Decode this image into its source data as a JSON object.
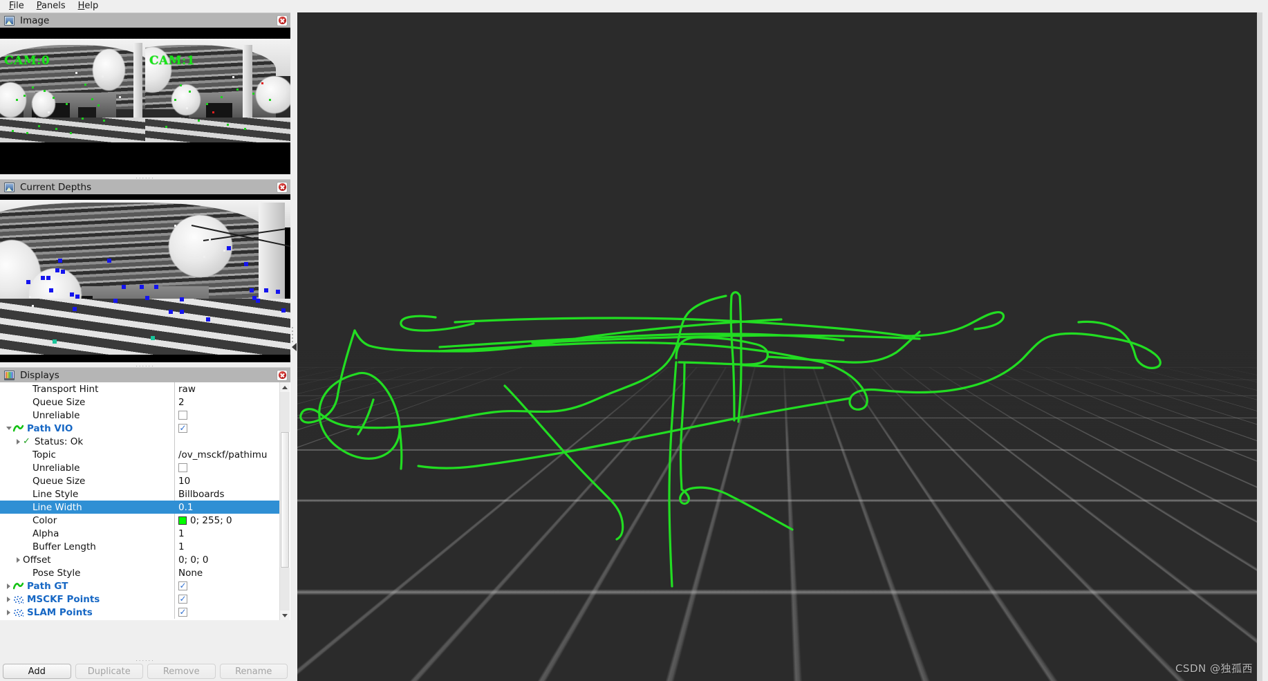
{
  "menu": {
    "items": [
      {
        "label": "File",
        "mnemonic": "F"
      },
      {
        "label": "Panels",
        "mnemonic": "P"
      },
      {
        "label": "Help",
        "mnemonic": "H"
      }
    ]
  },
  "panels": {
    "image": {
      "title": "Image",
      "icon": "image-panel-icon",
      "close_icon": "close-icon",
      "cam_labels": [
        "CAM:0",
        "CAM:1"
      ],
      "feature_color": "#1dd21d"
    },
    "depths": {
      "title": "Current Depths",
      "icon": "image-panel-icon",
      "close_icon": "close-icon",
      "feature_color": "#1414ee"
    },
    "displays": {
      "title": "Displays",
      "icon": "displays-panel-icon",
      "close_icon": "close-icon"
    }
  },
  "properties": [
    {
      "indent": 2,
      "arrow": "none",
      "label": "Transport Hint",
      "value": "raw",
      "value_type": "text",
      "group": false,
      "selected": false
    },
    {
      "indent": 2,
      "arrow": "none",
      "label": "Queue Size",
      "value": "2",
      "value_type": "text",
      "group": false,
      "selected": false
    },
    {
      "indent": 2,
      "arrow": "none",
      "label": "Unreliable",
      "value": "",
      "value_type": "checkbox_unchecked",
      "group": false,
      "selected": false
    },
    {
      "indent": 0,
      "arrow": "expanded",
      "label": "Path VIO",
      "value": "",
      "value_type": "checkbox_checked",
      "group": true,
      "icon": "path-icon",
      "selected": false
    },
    {
      "indent": 1,
      "arrow": "collapsed",
      "label": "Status: Ok",
      "value": "",
      "value_type": "none",
      "group": false,
      "icon": "status-ok-icon",
      "selected": false
    },
    {
      "indent": 2,
      "arrow": "none",
      "label": "Topic",
      "value": "/ov_msckf/pathimu",
      "value_type": "text",
      "group": false,
      "selected": false
    },
    {
      "indent": 2,
      "arrow": "none",
      "label": "Unreliable",
      "value": "",
      "value_type": "checkbox_unchecked",
      "group": false,
      "selected": false
    },
    {
      "indent": 2,
      "arrow": "none",
      "label": "Queue Size",
      "value": "10",
      "value_type": "text",
      "group": false,
      "selected": false
    },
    {
      "indent": 2,
      "arrow": "none",
      "label": "Line Style",
      "value": "Billboards",
      "value_type": "text",
      "group": false,
      "selected": false
    },
    {
      "indent": 2,
      "arrow": "none",
      "label": "Line Width",
      "value": "0.1",
      "value_type": "text",
      "group": false,
      "selected": true
    },
    {
      "indent": 2,
      "arrow": "none",
      "label": "Color",
      "value": "0; 255; 0",
      "value_type": "color",
      "swatch": "#00ff00",
      "group": false,
      "selected": false
    },
    {
      "indent": 2,
      "arrow": "none",
      "label": "Alpha",
      "value": "1",
      "value_type": "text",
      "group": false,
      "selected": false
    },
    {
      "indent": 2,
      "arrow": "none",
      "label": "Buffer Length",
      "value": "1",
      "value_type": "text",
      "group": false,
      "selected": false
    },
    {
      "indent": 1,
      "arrow": "collapsed",
      "label": "Offset",
      "value": "0; 0; 0",
      "value_type": "text",
      "group": false,
      "selected": false
    },
    {
      "indent": 2,
      "arrow": "none",
      "label": "Pose Style",
      "value": "None",
      "value_type": "text",
      "group": false,
      "selected": false
    },
    {
      "indent": 0,
      "arrow": "collapsed",
      "label": "Path GT",
      "value": "",
      "value_type": "checkbox_checked",
      "group": true,
      "icon": "path-icon",
      "selected": false
    },
    {
      "indent": 0,
      "arrow": "collapsed",
      "label": "MSCKF Points",
      "value": "",
      "value_type": "checkbox_checked",
      "group": true,
      "icon": "points-icon",
      "selected": false
    },
    {
      "indent": 0,
      "arrow": "collapsed",
      "label": "SLAM Points",
      "value": "",
      "value_type": "checkbox_checked",
      "group": true,
      "icon": "points-icon",
      "selected": false
    }
  ],
  "buttons": [
    {
      "label": "Add",
      "enabled": true
    },
    {
      "label": "Duplicate",
      "enabled": false
    },
    {
      "label": "Remove",
      "enabled": false
    },
    {
      "label": "Rename",
      "enabled": false
    }
  ],
  "render_view": {
    "background_color": "#2b2b2b",
    "grid_color": "#bebebe",
    "trajectory_color": "#22dd22",
    "splitter_icon": "collapse-left-arrow-icon",
    "scrollbar": "vertical-scrollbar"
  },
  "watermark": {
    "text": "CSDN @独孤西"
  }
}
